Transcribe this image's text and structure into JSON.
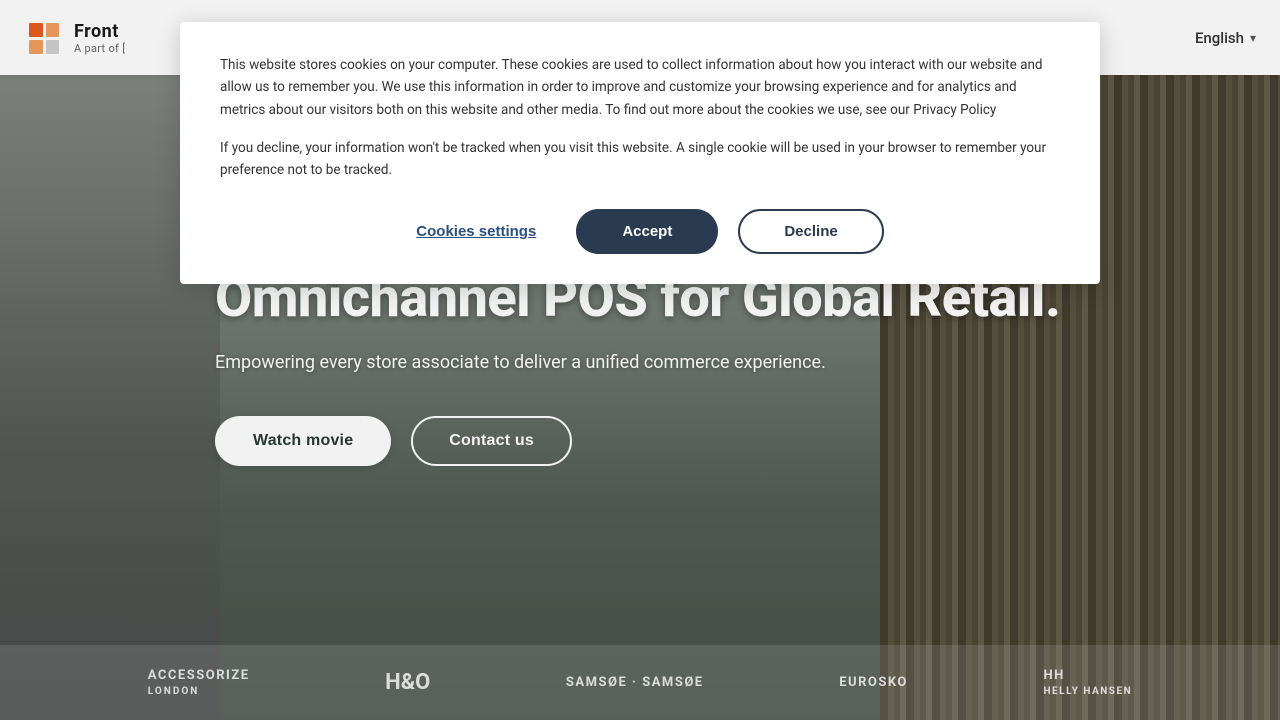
{
  "navbar": {
    "logo_title": "Front",
    "logo_subtitle": "A part of [",
    "language": "English",
    "chevron": "▾"
  },
  "hero": {
    "headline": "Omnichannel POS for Global Retail.",
    "subheadline": "Empowering every store associate to deliver a unified commerce experience.",
    "btn_watch": "Watch movie",
    "btn_contact": "Contact us"
  },
  "partners": [
    {
      "name": "ACCESSORIZE LONDON"
    },
    {
      "name": "H&O"
    },
    {
      "name": "SAMSØE SAMSØE"
    },
    {
      "name": "EUROSKO"
    },
    {
      "name": "HH HELLY HANSEN"
    }
  ],
  "cookie": {
    "text_main": "This website stores cookies on your computer. These cookies are used to collect information about how you interact with our website and allow us to remember you. We use this information in order to improve and customize your browsing experience and for analytics and metrics about our visitors both on this website and other media. To find out more about the cookies we use, see our Privacy Policy",
    "text_secondary": "If you decline, your information won't be tracked when you visit this website. A single cookie will be used in your browser to remember your preference not to be tracked.",
    "btn_settings": "Cookies settings",
    "btn_accept": "Accept",
    "btn_decline": "Decline"
  }
}
